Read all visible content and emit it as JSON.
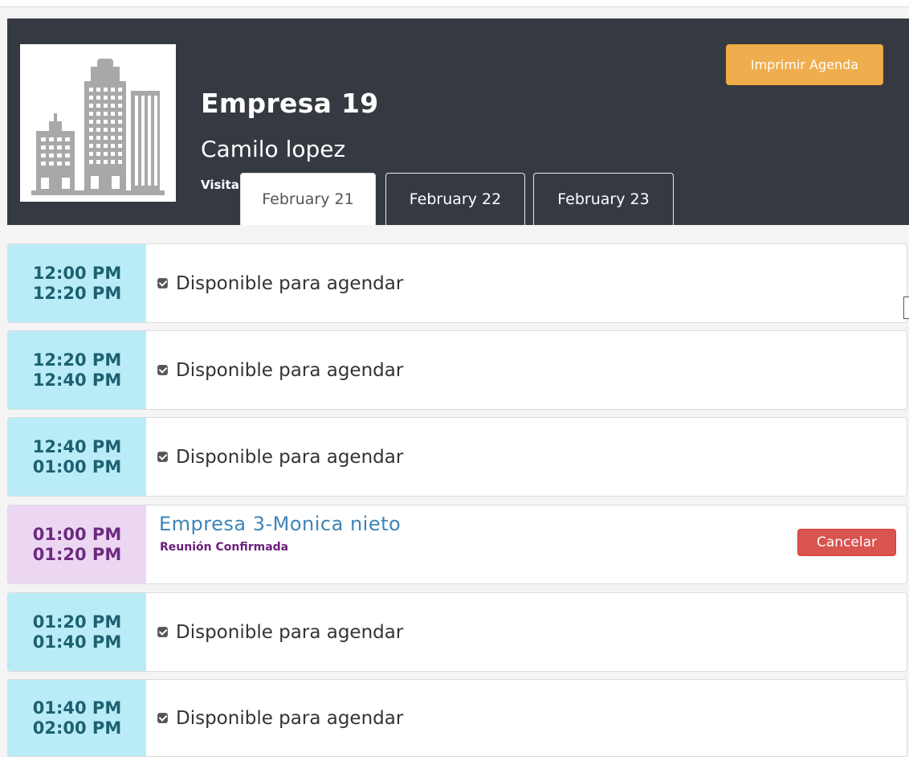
{
  "header": {
    "company": "Empresa 19",
    "contact": "Camilo lopez",
    "visit_label": "Visita",
    "print_button": "Imprimir Agenda",
    "logo_icon": "buildings-icon"
  },
  "tabs": [
    {
      "label": "February 21",
      "active": true
    },
    {
      "label": "February 22",
      "active": false
    },
    {
      "label": "February 23",
      "active": false
    }
  ],
  "slots": [
    {
      "start": "12:00 PM",
      "end": "12:20 PM",
      "status": "free",
      "text": "Disponible para agendar"
    },
    {
      "start": "12:20 PM",
      "end": "12:40 PM",
      "status": "free",
      "text": "Disponible para agendar"
    },
    {
      "start": "12:40 PM",
      "end": "01:00 PM",
      "status": "free",
      "text": "Disponible para agendar"
    },
    {
      "start": "01:00 PM",
      "end": "01:20 PM",
      "status": "booked",
      "title": "Empresa 3-Monica nieto",
      "subtitle": "Reunión Confirmada",
      "action": "Cancelar"
    },
    {
      "start": "01:20 PM",
      "end": "01:40 PM",
      "status": "free",
      "text": "Disponible para agendar"
    },
    {
      "start": "01:40 PM",
      "end": "02:00 PM",
      "status": "free",
      "text": "Disponible para agendar"
    }
  ],
  "colors": {
    "header_bg": "#353a42",
    "print_button": "#f0ad4e",
    "free_time_bg": "#b9ecf7",
    "booked_time_bg": "#ecd7f3",
    "cancel_button": "#d9534f",
    "meeting_title": "#3e84b8"
  }
}
